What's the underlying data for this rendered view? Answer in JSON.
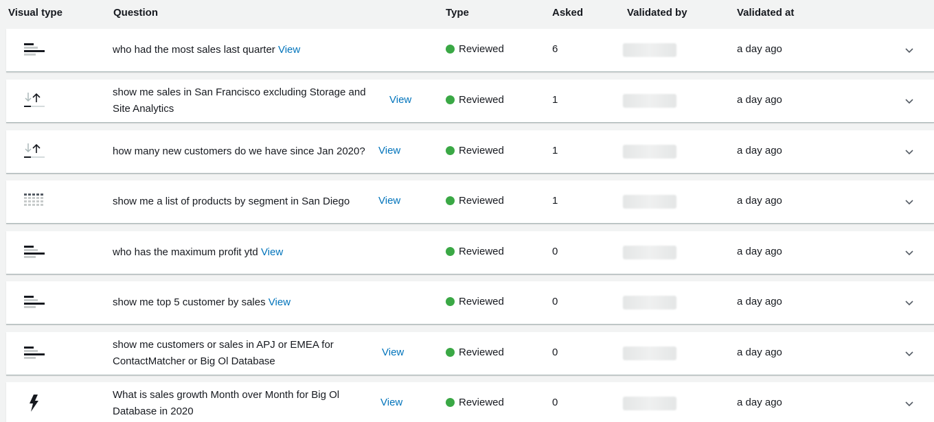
{
  "columns": {
    "visual_type": "Visual type",
    "question": "Question",
    "type": "Type",
    "asked": "Asked",
    "validated_by": "Validated by",
    "validated_at": "Validated at"
  },
  "rows": [
    {
      "visual": "bar-chart-icon",
      "question": "who had the most sales last quarter",
      "view": "View",
      "type": "Reviewed",
      "asked": "6",
      "validated_at": "a day ago"
    },
    {
      "visual": "sort-kpi-icon",
      "question": "show me sales in San Francisco excluding Storage and Site Analytics",
      "view": "View",
      "type": "Reviewed",
      "asked": "1",
      "validated_at": "a day ago"
    },
    {
      "visual": "sort-kpi-icon",
      "question": "how many new customers do we have since Jan 2020?",
      "view": "View",
      "type": "Reviewed",
      "asked": "1",
      "validated_at": "a day ago"
    },
    {
      "visual": "table-grid-icon",
      "question": "show me a list of products by segment in San Diego",
      "view": "View",
      "type": "Reviewed",
      "asked": "1",
      "validated_at": "a day ago"
    },
    {
      "visual": "bar-chart-icon",
      "question": "who has the maximum profit ytd",
      "view": "View",
      "type": "Reviewed",
      "asked": "0",
      "validated_at": "a day ago"
    },
    {
      "visual": "bar-chart-icon",
      "question": "show me top 5 customer by sales",
      "view": "View",
      "type": "Reviewed",
      "asked": "0",
      "validated_at": "a day ago"
    },
    {
      "visual": "bar-chart-icon",
      "question": "show me customers or sales in APJ or EMEA for ContactMatcher or Big Ol Database",
      "view": "View",
      "type": "Reviewed",
      "asked": "0",
      "validated_at": "a day ago"
    },
    {
      "visual": "lightning-icon",
      "question": "What is sales growth Month over Month for Big Ol Database in 2020",
      "view": "View",
      "type": "Reviewed",
      "asked": "0",
      "validated_at": "a day ago"
    }
  ],
  "colors": {
    "link": "#0073bb",
    "reviewed_dot": "#3aa845"
  }
}
